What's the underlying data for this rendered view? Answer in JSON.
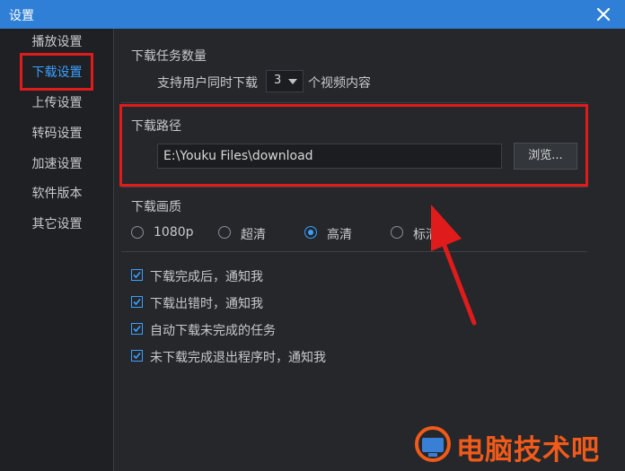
{
  "window": {
    "title": "设置",
    "close_icon": "close-icon"
  },
  "sidebar": {
    "items": [
      {
        "label": "播放设置",
        "active": false
      },
      {
        "label": "下载设置",
        "active": true
      },
      {
        "label": "上传设置",
        "active": false
      },
      {
        "label": "转码设置",
        "active": false
      },
      {
        "label": "加速设置",
        "active": false
      },
      {
        "label": "软件版本",
        "active": false
      },
      {
        "label": "其它设置",
        "active": false
      }
    ]
  },
  "download_tasks": {
    "heading": "下载任务数量",
    "prefix": "支持用户同时下载",
    "value": "3",
    "suffix": "个视频内容"
  },
  "download_path": {
    "heading": "下载路径",
    "value": "E:\\Youku Files\\download",
    "browse_label": "浏览..."
  },
  "quality": {
    "heading": "下载画质",
    "options": [
      {
        "label": "1080p",
        "selected": false
      },
      {
        "label": "超清",
        "selected": false
      },
      {
        "label": "高清",
        "selected": true
      },
      {
        "label": "标清",
        "selected": false
      }
    ]
  },
  "notifications": [
    {
      "label": "下载完成后，通知我",
      "checked": true
    },
    {
      "label": "下载出错时，通知我",
      "checked": true
    },
    {
      "label": "自动下载未完成的任务",
      "checked": true
    },
    {
      "label": "未下载完成退出程序时，通知我",
      "checked": true
    }
  ],
  "watermark": {
    "text": "电脑技术吧"
  },
  "colors": {
    "accent": "#3aa0ff",
    "titlebar": "#2f7fd6",
    "annotation": "#e01b1b",
    "watermark": "#f05a1a"
  }
}
